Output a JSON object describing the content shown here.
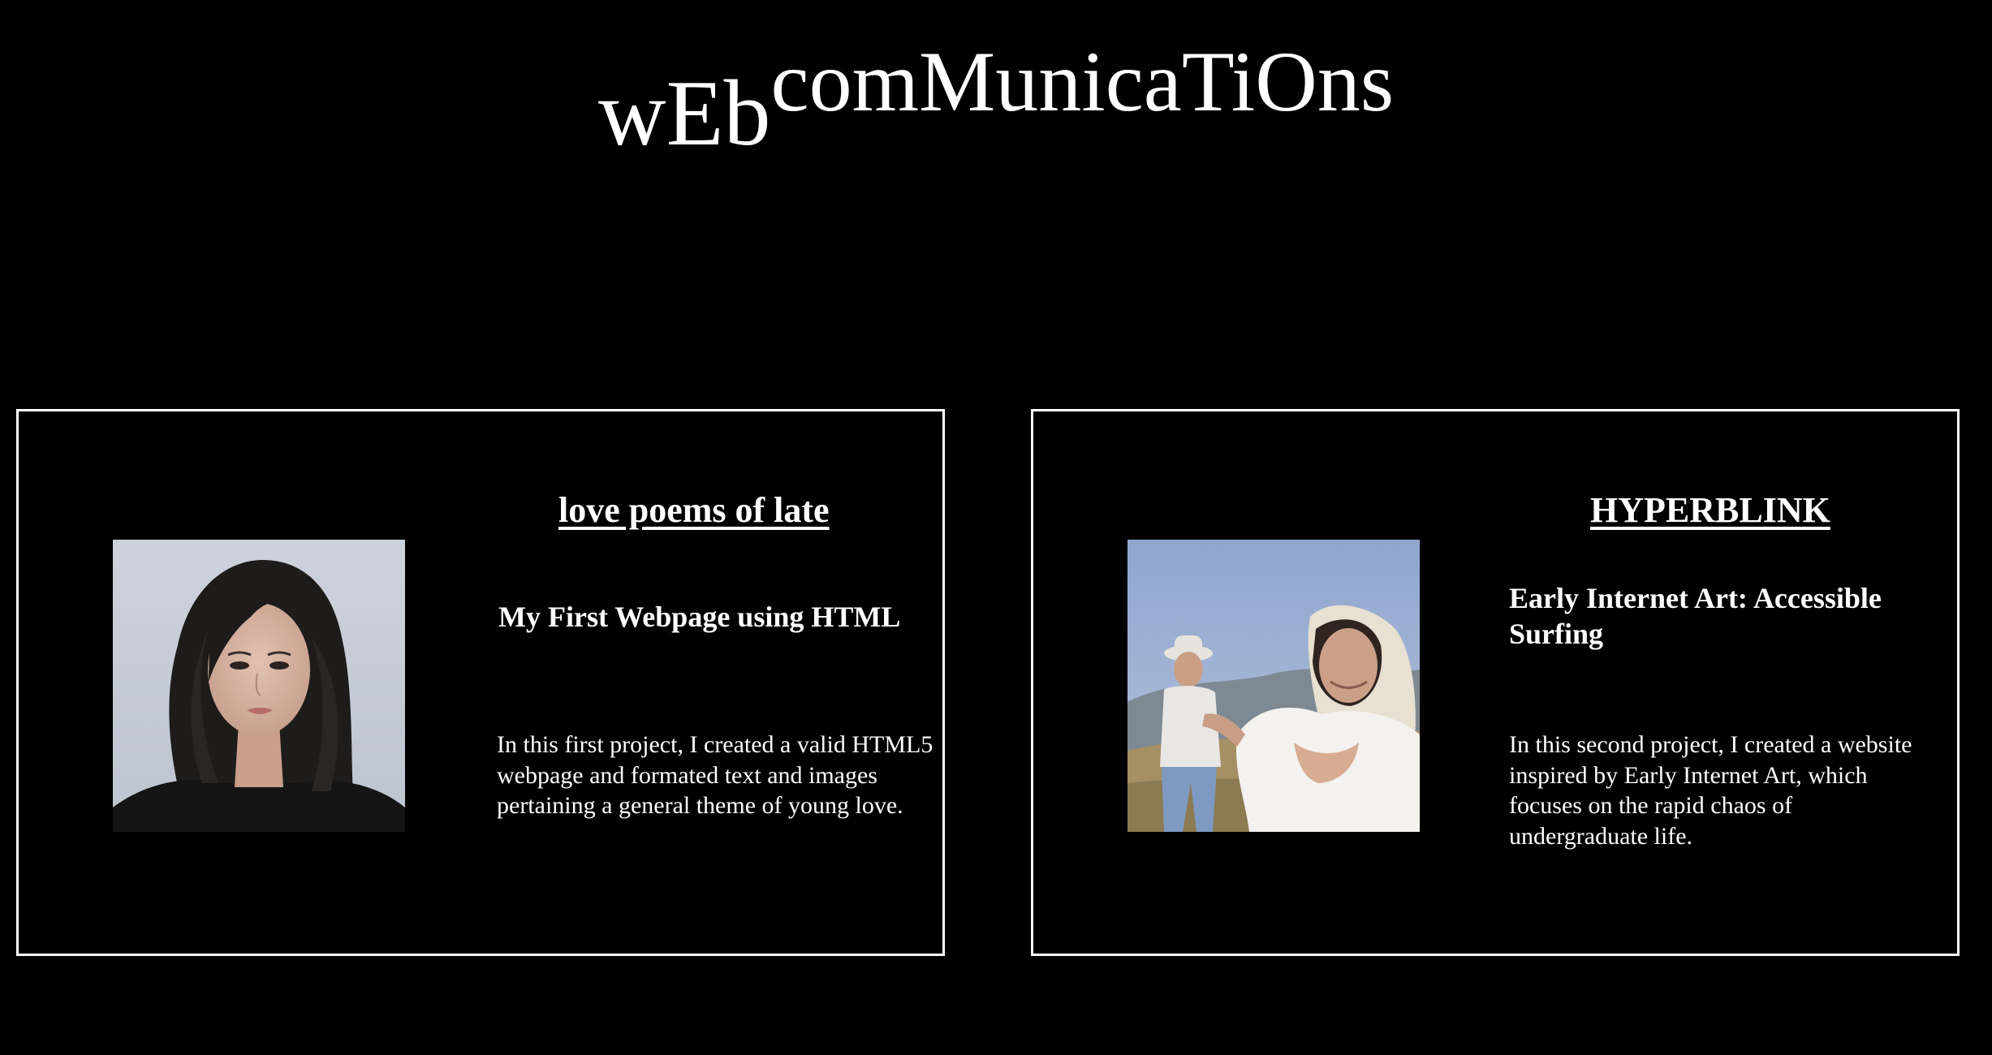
{
  "site": {
    "title_sub": "wEb",
    "title_sup": "comMunicaTiOns"
  },
  "projects": [
    {
      "link_label": "love poems of late",
      "subtitle": "My First Webpage using HTML",
      "description": "In this first project, I created a valid HTML5 webpage and formated text and images pertaining a general theme of young love.",
      "photo": "portrait-photo"
    },
    {
      "link_label": "HYPERBLINK",
      "subtitle": "Early Internet Art: Accessible Surfing",
      "description": "In this second project, I created a website inspired by Early Internet Art, which focuses on the rapid chaos of undergraduate life.",
      "photo": "field-couple-photo"
    }
  ],
  "colors": {
    "background": "#000000",
    "text": "#ffffff",
    "border": "#ffffff"
  }
}
